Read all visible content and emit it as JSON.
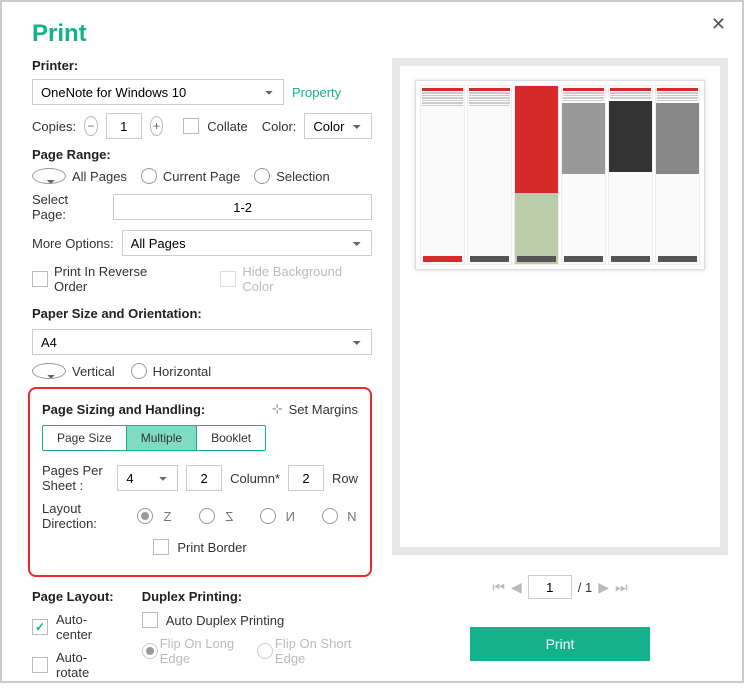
{
  "title": "Print",
  "printer": {
    "label": "Printer:",
    "value": "OneNote for Windows 10",
    "property": "Property"
  },
  "copies": {
    "label": "Copies:",
    "value": "1",
    "collate": "Collate",
    "collate_checked": false,
    "color_label": "Color:",
    "color_value": "Color"
  },
  "range": {
    "label": "Page Range:",
    "all": "All Pages",
    "current": "Current Page",
    "selection": "Selection",
    "select_label": "Select Page:",
    "select_value": "1-2",
    "more_label": "More Options:",
    "more_value": "All Pages",
    "reverse": "Print In Reverse Order",
    "hide_bg": "Hide Background Color"
  },
  "paper": {
    "label": "Paper Size and Orientation:",
    "value": "A4",
    "vertical": "Vertical",
    "horizontal": "Horizontal"
  },
  "sizing": {
    "label": "Page Sizing and Handling:",
    "margins": "Set Margins",
    "tab_size": "Page Size",
    "tab_multiple": "Multiple",
    "tab_booklet": "Booklet",
    "pps_label": "Pages Per Sheet :",
    "pps_value": "4",
    "col_value": "2",
    "col_label": "Column*",
    "row_value": "2",
    "row_label": "Row",
    "layout_label": "Layout Direction:",
    "border": "Print Border"
  },
  "layout": {
    "label": "Page Layout:",
    "auto_center": "Auto-center",
    "auto_rotate": "Auto-rotate",
    "duplex_label": "Duplex Printing:",
    "auto_duplex": "Auto Duplex Printing",
    "long_edge": "Flip On Long Edge",
    "short_edge": "Flip On Short Edge"
  },
  "pager": {
    "value": "1",
    "total": "/ 1"
  },
  "print_btn": "Print"
}
